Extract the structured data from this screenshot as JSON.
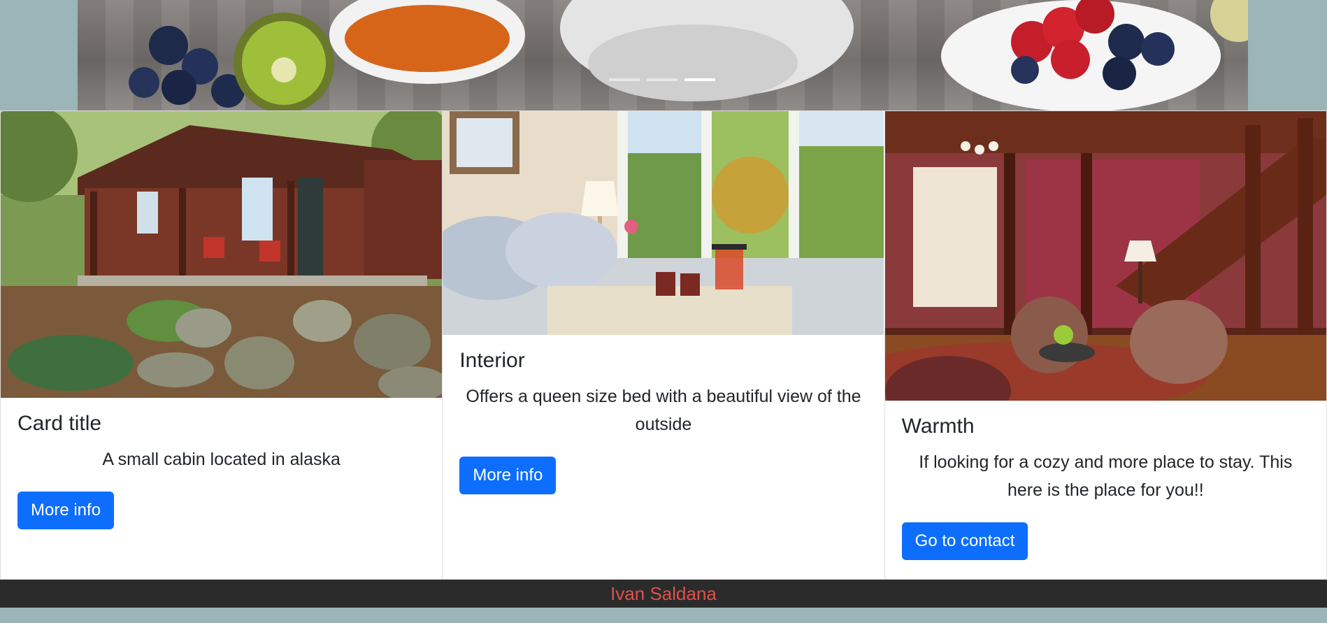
{
  "carousel": {
    "image_icon": "breakfast-image",
    "indicators": [
      {
        "label": "Slide 1",
        "active": false
      },
      {
        "label": "Slide 2",
        "active": false
      },
      {
        "label": "Slide 3",
        "active": true
      }
    ]
  },
  "cards": [
    {
      "image_icon": "cabin-image",
      "title": "Card title",
      "text": "A small cabin located in alaska",
      "button": "More info"
    },
    {
      "image_icon": "bedroom-image",
      "title": "Interior",
      "text": "Offers a queen size bed with a beautiful view of the outside",
      "button": "More info"
    },
    {
      "image_icon": "living-room-image",
      "title": "Warmth",
      "text": "If looking for a cozy and more place to stay. This here is the place for you!!",
      "button": "Go to contact"
    }
  ],
  "footer": {
    "author": "Ivan Saldana"
  },
  "colors": {
    "page_bg": "#9bb5b8",
    "primary": "#0d6efd",
    "footer_bg": "#2b2b2b",
    "footer_text": "#e0504a"
  }
}
